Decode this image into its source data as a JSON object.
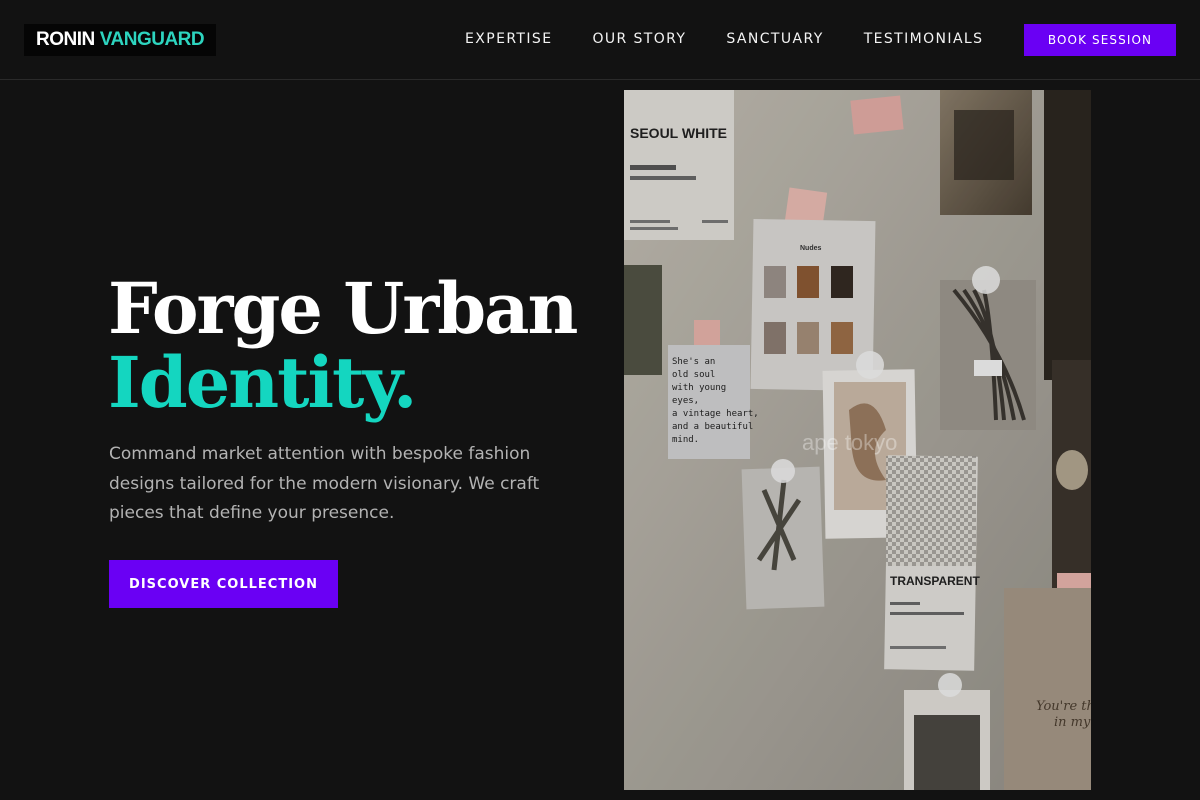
{
  "header": {
    "logo": {
      "part1": "RONIN",
      "part2": "VANGUARD"
    },
    "nav": [
      "EXPERTISE",
      "OUR STORY",
      "SANCTUARY",
      "TESTIMONIALS"
    ],
    "cta_label": "BOOK SESSION"
  },
  "hero": {
    "title_line1": "Forge Urban",
    "title_line2": "Identity.",
    "subtitle": "Command market attention with bespoke fashion designs tailored for the modern visionary. We craft pieces that define your presence.",
    "cta_label": "DISCOVER COLLECTION"
  },
  "photo": {
    "card1_title": "SEOUL WHITE",
    "card2_title": "Nudes",
    "card3_title": "TRANSPARENT",
    "note_text": [
      "She's an",
      "old soul",
      "with young",
      "eyes,",
      "a vintage heart,",
      "and a beautiful",
      "mind."
    ],
    "watermark": "ape tokyo",
    "handwriting": [
      "You're the",
      "in my"
    ]
  },
  "colors": {
    "background": "#121212",
    "accent_purple": "#6a00f4",
    "accent_teal": "#14d6c0"
  }
}
